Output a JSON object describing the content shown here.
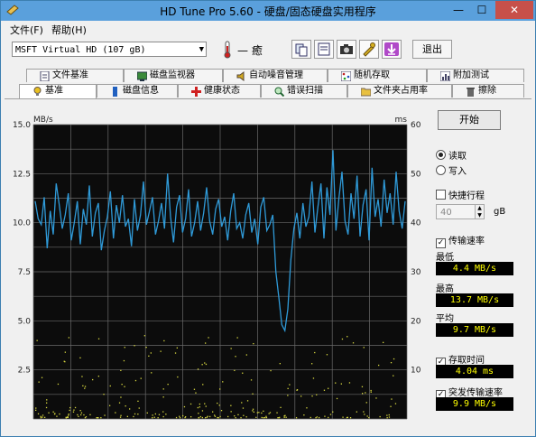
{
  "window": {
    "title": "HD Tune Pro 5.60 - 硬盘/固态硬盘实用程序",
    "minimize": "—",
    "maximize": "☐",
    "close": "✕"
  },
  "menu": {
    "file": "文件(F)",
    "help": "帮助(H)"
  },
  "toolbar": {
    "drive": "MSFT   Virtual HD (107 gB)",
    "temperature": "— 癒",
    "exit_label": "退出"
  },
  "tabs_top": [
    "文件基准",
    "磁盘监视器",
    "自动噪音管理",
    "随机存取",
    "附加测试"
  ],
  "tabs_bottom": [
    "基准",
    "磁盘信息",
    "健康状态",
    "错误扫描",
    "文件夹占用率",
    "擦除"
  ],
  "side": {
    "start_label": "开始",
    "read_label": "读取",
    "write_label": "写入",
    "short_stroke_label": "快捷行程",
    "short_stroke_value": "40",
    "short_stroke_unit": "gB",
    "transfer_rate_label": "传输速率",
    "min_label": "最低",
    "min_value": "4.4 MB/s",
    "max_label": "最高",
    "max_value": "13.7 MB/s",
    "avg_label": "平均",
    "avg_value": "9.7 MB/s",
    "access_time_label": "存取时间",
    "access_time_value": "4.04 ms",
    "burst_label": "突发传输速率",
    "burst_value": "9.9 MB/s"
  },
  "chart_data": {
    "type": "line",
    "left_unit": "MB/s",
    "right_unit": "ms",
    "left_ticks": [
      "15.0",
      "12.5",
      "10.0",
      "7.5",
      "5.0",
      "2.5"
    ],
    "right_ticks": [
      "60",
      "50",
      "40",
      "30",
      "20",
      "10"
    ],
    "ylim": [
      0,
      15
    ],
    "y2lim": [
      0,
      60
    ],
    "grid": true,
    "colors": {
      "line": "#2f9ad8",
      "dots": "#d8d840",
      "background": "#0c0c0c",
      "grid": "#6a6a6a"
    },
    "transfer_mbps": [
      11.1,
      10.2,
      9.9,
      11.3,
      8.7,
      10.6,
      9.4,
      12.0,
      10.9,
      9.7,
      10.4,
      11.5,
      9.1,
      10.0,
      11.1,
      8.9,
      10.7,
      9.9,
      11.9,
      9.3,
      10.5,
      11.0,
      8.6,
      9.6,
      10.3,
      11.6,
      9.2,
      10.9,
      10.0,
      11.4,
      9.8,
      10.2,
      8.8,
      11.2,
      9.6,
      10.4,
      12.1,
      9.9,
      10.6,
      11.3,
      9.4,
      10.1,
      11.0,
      9.7,
      12.5,
      10.3,
      9.0,
      10.8,
      11.4,
      9.5,
      10.2,
      11.7,
      9.3,
      10.0,
      11.1,
      9.6,
      10.5,
      11.8,
      10.1,
      9.4,
      10.7,
      11.2,
      9.8,
      10.3,
      9.1,
      10.6,
      11.5,
      9.7,
      10.0,
      9.2,
      10.4,
      11.0,
      9.5,
      10.2,
      8.9,
      10.8,
      11.3,
      9.6,
      9.9,
      10.4,
      7.5,
      6.2,
      4.8,
      4.5,
      5.6,
      8.1,
      9.7,
      10.5,
      9.2,
      11.0,
      9.8,
      10.3,
      12.1,
      9.5,
      10.8,
      12.0,
      9.2,
      11.8,
      10.4,
      13.7,
      9.6,
      11.3,
      12.6,
      10.1,
      9.4,
      11.5,
      10.2,
      12.4,
      9.3,
      10.9,
      11.7,
      9.1,
      12.8,
      10.3,
      11.2,
      9.8,
      12.2,
      10.5,
      11.5,
      9.9,
      12.6,
      10.6,
      9.7,
      11.1
    ]
  }
}
